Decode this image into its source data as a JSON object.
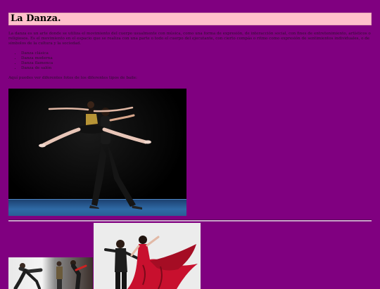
{
  "header": {
    "title": "La Danza."
  },
  "content": {
    "intro": "La danza es un arte donde se utiliza el movimiento del cuerpo usualmente con música, como una forma de expresión, de interacción social, con fines de entretenimiento, artísticos o religiosos. Es el movimiento en el espacio que se realiza con una parte o todo el cuerpo del ejecutante, con cierto compás o ritmo como expresión de sentimientos individuales, o de símbolos de la cultura y la sociedad.",
    "types": [
      "Danza clásica",
      "Danza moderna",
      "Danza flamenca",
      "Danza de salón"
    ],
    "caption": "Aquí puedes ver diferentes fotos de los diferentes tipos de baile:"
  },
  "images": {
    "ballet": "ballet-photo",
    "urban": "urban-dance-photo",
    "flamenco": "flamenco-photo"
  },
  "colors": {
    "page_background": "#800080",
    "title_background": "#ffc0cb",
    "stage": "#2f6aa6",
    "flamenco_dress": "#c8102e"
  }
}
